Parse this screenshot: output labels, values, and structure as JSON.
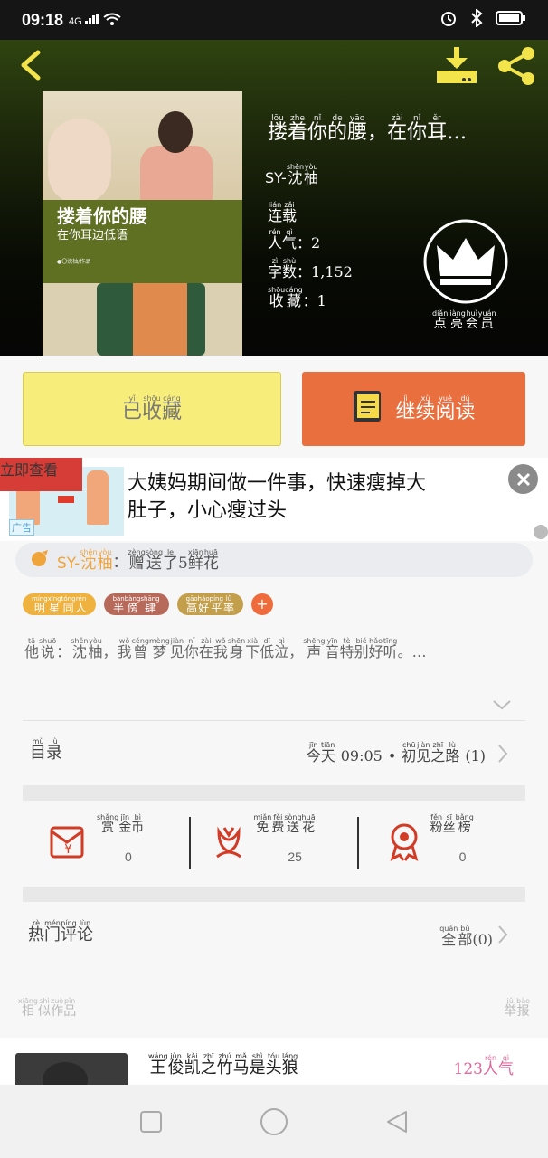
{
  "status_bar": {
    "time": "09:18",
    "network": "4G",
    "icons": [
      "alarm-icon",
      "bluetooth-icon",
      "battery-icon"
    ]
  },
  "header": {
    "back_icon": "back-arrow-icon",
    "download_icon": "download-icon",
    "share_icon": "share-icon"
  },
  "cover": {
    "title_main": "搂着你的腰",
    "title_sub": "在你耳边低语",
    "author_line": "●〇沈柚/作品"
  },
  "book": {
    "title": [
      [
        "lōu",
        "搂"
      ],
      [
        "zhe",
        "着"
      ],
      [
        "nǐ",
        "你"
      ],
      [
        "de",
        "的"
      ],
      [
        "yāo",
        "腰"
      ],
      [
        "",
        "，"
      ],
      [
        "zài",
        "在"
      ],
      [
        "nǐ",
        "你"
      ],
      [
        "ěr",
        "耳"
      ],
      [
        "",
        "…"
      ]
    ],
    "author_prefix": "SY-",
    "author": [
      [
        "shěn",
        "沈"
      ],
      [
        "yòu",
        "柚"
      ]
    ],
    "status": [
      [
        "lián",
        "连"
      ],
      [
        "zǎi",
        "载"
      ]
    ],
    "stats": [
      {
        "label": [
          [
            "rén",
            "人"
          ],
          [
            "qì",
            "气"
          ]
        ],
        "sep": "：",
        "value": "2"
      },
      {
        "label": [
          [
            "zì",
            "字"
          ],
          [
            "shù",
            "数"
          ]
        ],
        "sep": "：",
        "value": "1,152"
      },
      {
        "label": [
          [
            "shōu",
            "收"
          ],
          [
            "cáng",
            "藏"
          ]
        ],
        "sep": "：",
        "value": "1"
      }
    ]
  },
  "crown": {
    "icon": "crown-icon",
    "label": [
      [
        "diǎn",
        "点"
      ],
      [
        "liàng",
        "亮"
      ],
      [
        "huì",
        "会"
      ],
      [
        "yuán",
        "员"
      ]
    ]
  },
  "buttons": {
    "favorited": [
      [
        "yǐ",
        "已"
      ],
      [
        "shōu",
        "收"
      ],
      [
        "cáng",
        "藏"
      ]
    ],
    "continue_read": [
      [
        "jì",
        "继"
      ],
      [
        "xù",
        "续"
      ],
      [
        "yuè",
        "阅"
      ],
      [
        "dú",
        "读"
      ]
    ]
  },
  "ad": {
    "text": "大姨妈期间做一件事，快速瘦掉大肚子，小心瘦过头",
    "cta": "立即查看",
    "tag": "广告"
  },
  "gift": {
    "author_prefix": "SY-",
    "author": [
      [
        "shěn",
        "沈"
      ],
      [
        "yòu",
        "柚"
      ]
    ],
    "sep": "：",
    "msg": [
      [
        "zèng",
        "赠"
      ],
      [
        "sòng",
        "送"
      ],
      [
        "le",
        "了"
      ],
      [
        "",
        "5"
      ],
      [
        "xiān",
        "鲜"
      ],
      [
        "huā",
        "花"
      ]
    ]
  },
  "tags": [
    [
      [
        "míng",
        "明"
      ],
      [
        "xīng",
        "星"
      ],
      [
        "tóng",
        "同"
      ],
      [
        "rén",
        "人"
      ]
    ],
    [
      [
        "bàn",
        "半"
      ],
      [
        "bàng",
        "傍"
      ],
      [
        "shāng",
        "肆"
      ]
    ],
    [
      [
        "gāo",
        "高"
      ],
      [
        "hǎo",
        "好"
      ],
      [
        "píng",
        "平"
      ],
      [
        "lǜ",
        "率"
      ]
    ]
  ],
  "description": [
    [
      "tā",
      "他"
    ],
    [
      "shuō",
      "说"
    ],
    [
      "",
      "："
    ],
    [
      "shěn",
      "沈"
    ],
    [
      "yòu",
      "柚"
    ],
    [
      "",
      "，"
    ],
    [
      "wǒ",
      "我"
    ],
    [
      "céng",
      "曾"
    ],
    [
      "mèng",
      "梦"
    ],
    [
      "jiàn",
      "见"
    ],
    [
      "nǐ",
      "你"
    ],
    [
      "zài",
      "在"
    ],
    [
      "wǒ",
      "我"
    ],
    [
      "shēn",
      "身"
    ],
    [
      "xià",
      "下"
    ],
    [
      "dī",
      "低"
    ],
    [
      "qì",
      "泣"
    ],
    [
      "",
      "，"
    ],
    [
      "shēng",
      "声"
    ],
    [
      "yīn",
      "音"
    ],
    [
      "tè",
      "特"
    ],
    [
      "bié",
      "别"
    ],
    [
      "hǎo",
      "好"
    ],
    [
      "tīng",
      "听"
    ],
    [
      "",
      "。"
    ],
    [
      "",
      "…"
    ]
  ],
  "toc": {
    "label": [
      [
        "mù",
        "目"
      ],
      [
        "lù",
        "录"
      ]
    ],
    "today": [
      [
        "jīn",
        "今"
      ],
      [
        "tiān",
        "天"
      ]
    ],
    "time": "09:05",
    "dot": "•",
    "chapter": [
      [
        "chū",
        "初"
      ],
      [
        "jiàn",
        "见"
      ],
      [
        "zhī",
        "之"
      ],
      [
        "lù",
        "路"
      ]
    ],
    "num": "(1)"
  },
  "rewards": [
    {
      "icon": "red-envelope-icon",
      "label": [
        [
          "shǎng",
          "赏"
        ],
        [
          "jīn",
          "金"
        ],
        [
          "bì",
          "币"
        ]
      ],
      "value": "0"
    },
    {
      "icon": "flower-icon",
      "label": [
        [
          "miǎn",
          "免"
        ],
        [
          "fèi",
          "费"
        ],
        [
          "sòng",
          "送"
        ],
        [
          "huā",
          "花"
        ]
      ],
      "value": "25"
    },
    {
      "icon": "medal-icon",
      "label": [
        [
          "fěn",
          "粉"
        ],
        [
          "sī",
          "丝"
        ],
        [
          "bǎng",
          "榜"
        ]
      ],
      "value": "0"
    }
  ],
  "hot_comments": {
    "label": [
      [
        "rè",
        "热"
      ],
      [
        "mén",
        "门"
      ],
      [
        "píng",
        "评"
      ],
      [
        "lùn",
        "论"
      ]
    ],
    "all": [
      [
        "quán",
        "全"
      ],
      [
        "bù",
        "部"
      ]
    ],
    "count": "(0)"
  },
  "similar": {
    "label": [
      [
        "xiāng",
        "相"
      ],
      [
        "shì",
        "似"
      ],
      [
        "zuò",
        "作"
      ],
      [
        "pǐn",
        "品"
      ]
    ],
    "report": [
      [
        "jǔ",
        "举"
      ],
      [
        "bào",
        "报"
      ]
    ]
  },
  "recommend": {
    "title": [
      [
        "wáng",
        "王"
      ],
      [
        "jùn",
        "俊"
      ],
      [
        "kǎi",
        "凯"
      ],
      [
        "zhī",
        "之"
      ],
      [
        "zhú",
        "竹"
      ],
      [
        "mǎ",
        "马"
      ],
      [
        "shì",
        "是"
      ],
      [
        "tóu",
        "头"
      ],
      [
        "láng",
        "狼"
      ]
    ],
    "pop_value": "123",
    "pop_label": [
      [
        "rén",
        "人"
      ],
      [
        "qì",
        "气"
      ]
    ]
  },
  "navbar": {
    "icons": [
      "recent-apps-icon",
      "home-icon",
      "back-icon"
    ]
  },
  "colors": {
    "accent_yellow": "#f2e44a",
    "accent_orange": "#e96f3f",
    "fav_bg": "#f7ed7a",
    "ad_cta": "#d73d37"
  }
}
